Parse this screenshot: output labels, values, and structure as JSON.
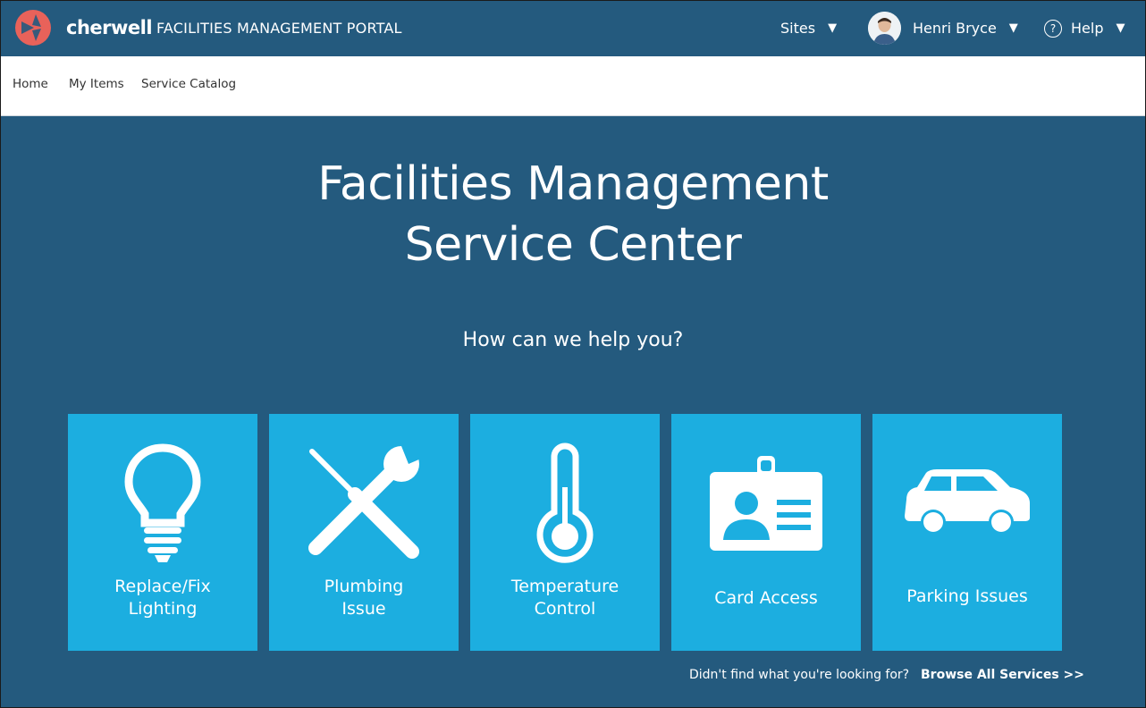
{
  "header": {
    "brand": "cherwell",
    "portal_title": "FACILITIES MANAGEMENT PORTAL",
    "sites_label": "Sites",
    "user_name": "Henri Bryce",
    "help_label": "Help",
    "caret": "▼",
    "help_glyph": "?"
  },
  "nav": {
    "items": [
      "Home",
      "My Items",
      "Service Catalog"
    ]
  },
  "hero": {
    "title_line1": "Facilities Management",
    "title_line2": "Service Center",
    "subtitle": "How can we help you?"
  },
  "tiles": [
    {
      "line1": "Replace/Fix",
      "line2": "Lighting",
      "icon": "lightbulb-icon"
    },
    {
      "line1": "Plumbing",
      "line2": "Issue",
      "icon": "tools-icon"
    },
    {
      "line1": "Temperature",
      "line2": "Control",
      "icon": "thermometer-icon"
    },
    {
      "line1": "Card Access",
      "line2": "",
      "icon": "id-card-icon"
    },
    {
      "line1": "Parking Issues",
      "line2": "",
      "icon": "car-icon"
    }
  ],
  "footer": {
    "question": "Didn't find what you're looking for?",
    "browse_link": "Browse All Services >>"
  },
  "colors": {
    "header_bg": "#245a7e",
    "tile_bg": "#1caee0",
    "logo_accent": "#e8625a"
  }
}
